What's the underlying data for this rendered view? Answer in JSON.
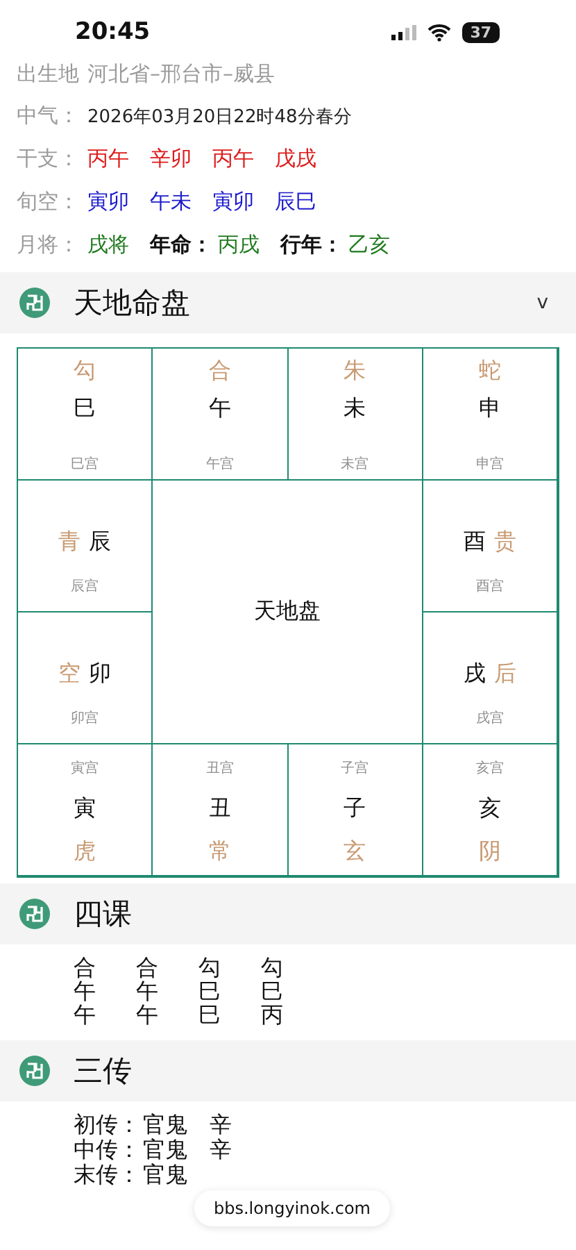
{
  "status_bar": {
    "time": "20:45",
    "battery": "37"
  },
  "info": [
    {
      "label": "出生地",
      "items": [
        {
          "kind": "value",
          "text": "河北省–邢台市–威县",
          "color": "#9a9a9a"
        }
      ]
    },
    {
      "label": "中气：",
      "items": [
        {
          "kind": "value",
          "text": "2026年03月20日22时48分春分",
          "color": "#222222"
        }
      ]
    },
    {
      "label": "干支：",
      "items": [
        {
          "kind": "value",
          "text": "丙午",
          "color": "#dd1a1a"
        },
        {
          "kind": "value",
          "text": "辛卯",
          "color": "#dd1a1a"
        },
        {
          "kind": "value",
          "text": "丙午",
          "color": "#dd1a1a"
        },
        {
          "kind": "value",
          "text": "戊戌",
          "color": "#dd1a1a"
        }
      ]
    },
    {
      "label": "旬空：",
      "items": [
        {
          "kind": "value",
          "text": "寅卯",
          "color": "#1a1acc"
        },
        {
          "kind": "value",
          "text": "午未",
          "color": "#1a1acc"
        },
        {
          "kind": "value",
          "text": "寅卯",
          "color": "#1a1acc"
        },
        {
          "kind": "value",
          "text": "辰巳",
          "color": "#1a1acc"
        }
      ]
    },
    {
      "label": "月将：",
      "items": [
        {
          "kind": "value",
          "text": "戌将",
          "color": "#1e7a1e"
        },
        {
          "kind": "label",
          "text": "年命："
        },
        {
          "kind": "value",
          "text": "丙戌",
          "color": "#1e7a1e"
        },
        {
          "kind": "label",
          "text": "行年："
        },
        {
          "kind": "value",
          "text": "乙亥",
          "color": "#1e7a1e"
        }
      ]
    }
  ],
  "board_section": {
    "title": "天地命盘",
    "toggle": "v"
  },
  "board": {
    "center": "天地盘",
    "cells": [
      {
        "general": "勾",
        "branch": "巳",
        "palace": "巳宫"
      },
      {
        "general": "合",
        "branch": "午",
        "palace": "午宫"
      },
      {
        "general": "朱",
        "branch": "未",
        "palace": "未宫"
      },
      {
        "general": "蛇",
        "branch": "申",
        "palace": "申宫"
      },
      {
        "general": "青",
        "branch": "辰",
        "palace": "辰宫"
      },
      {
        "general": "贵",
        "branch": "酉",
        "palace": "酉宫"
      },
      {
        "general": "空",
        "branch": "卯",
        "palace": "卯宫"
      },
      {
        "general": "后",
        "branch": "戌",
        "palace": "戌宫"
      },
      {
        "general": "虎",
        "branch": "寅",
        "palace": "寅宫"
      },
      {
        "general": "常",
        "branch": "丑",
        "palace": "丑宫"
      },
      {
        "general": "玄",
        "branch": "子",
        "palace": "子宫"
      },
      {
        "general": "阴",
        "branch": "亥",
        "palace": "亥宫"
      }
    ]
  },
  "four_lessons": {
    "title": "四课",
    "rows": [
      [
        "合",
        "合",
        "勾",
        "勾"
      ],
      [
        "午",
        "午",
        "巳",
        "巳"
      ],
      [
        "午",
        "午",
        "巳",
        "丙"
      ]
    ]
  },
  "three_transmissions": {
    "title": "三传",
    "rows": [
      {
        "label": "初传：",
        "relation": "官鬼",
        "stem": "辛"
      },
      {
        "label": "中传：",
        "relation": "官鬼",
        "stem": "辛"
      },
      {
        "label": "末传：",
        "relation": "官鬼"
      }
    ]
  },
  "url_pill": "bbs.longyinok.com"
}
